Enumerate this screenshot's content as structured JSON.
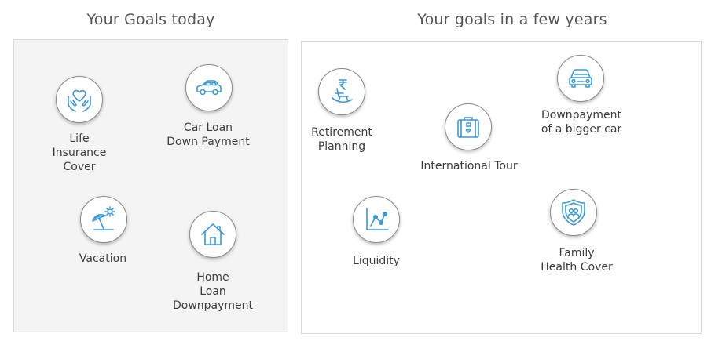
{
  "today": {
    "title": "Your Goals today",
    "goals": [
      {
        "label": "Life\nInsurance\nCover",
        "icon": "heart-hands-icon"
      },
      {
        "label": "Car Loan\nDown Payment",
        "icon": "car-icon"
      },
      {
        "label": "Vacation",
        "icon": "beach-umbrella-icon"
      },
      {
        "label": "Home\nLoan\nDownpayment",
        "icon": "house-icon"
      }
    ]
  },
  "future": {
    "title": "Your goals in a few years",
    "goals": [
      {
        "label": "Retirement\nPlanning",
        "icon": "rocking-chair-rupee-icon"
      },
      {
        "label": "International Tour",
        "icon": "suitcase-icon"
      },
      {
        "label": "Downpayment\nof a bigger car",
        "icon": "car-front-icon"
      },
      {
        "label": "Liquidity",
        "icon": "line-chart-icon"
      },
      {
        "label": "Family\nHealth Cover",
        "icon": "family-shield-icon"
      }
    ]
  },
  "colors": {
    "icon_blue": "#3a9ad9",
    "panel_gray": "#f4f4f4",
    "border": "#d9d9d9",
    "text": "#3d3d3d"
  }
}
